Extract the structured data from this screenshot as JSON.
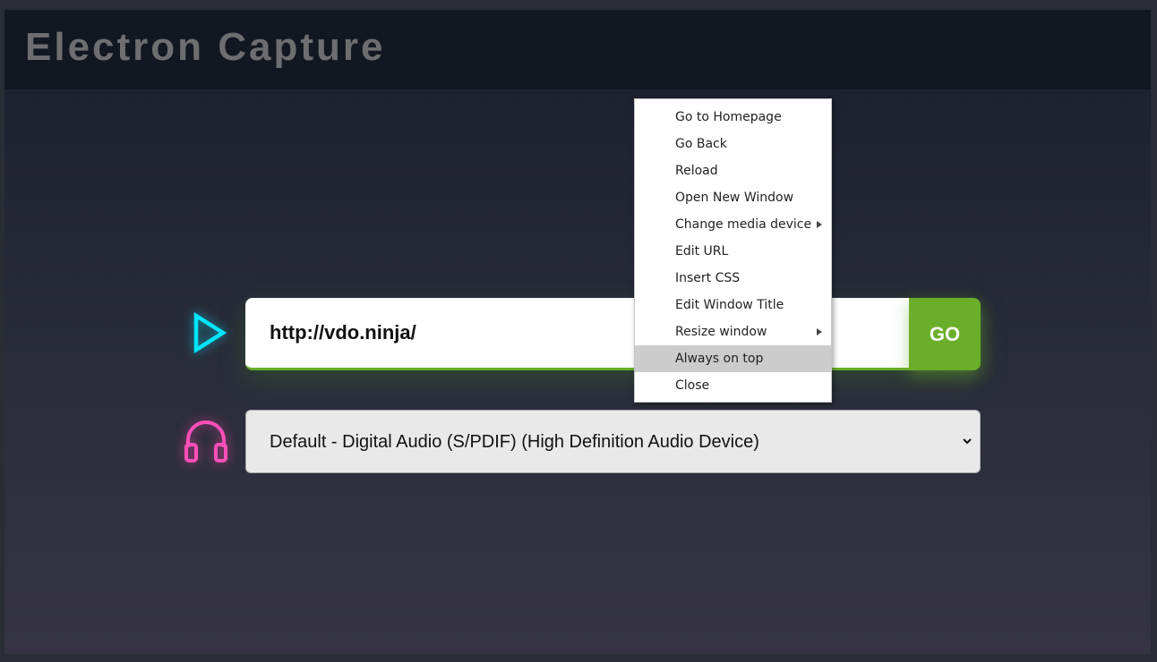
{
  "app": {
    "title": "Electron Capture"
  },
  "url_bar": {
    "value": "http://vdo.ninja/",
    "go_label": "GO"
  },
  "audio_device": {
    "selected": "Default - Digital Audio (S/PDIF) (High Definition Audio Device)"
  },
  "context_menu": {
    "items": [
      {
        "label": "Go to Homepage",
        "submenu": false,
        "highlighted": false
      },
      {
        "label": "Go Back",
        "submenu": false,
        "highlighted": false
      },
      {
        "label": "Reload",
        "submenu": false,
        "highlighted": false
      },
      {
        "label": "Open New Window",
        "submenu": false,
        "highlighted": false
      },
      {
        "label": "Change media device",
        "submenu": true,
        "highlighted": false
      },
      {
        "label": "Edit URL",
        "submenu": false,
        "highlighted": false
      },
      {
        "label": "Insert CSS",
        "submenu": false,
        "highlighted": false
      },
      {
        "label": "Edit Window Title",
        "submenu": false,
        "highlighted": false
      },
      {
        "label": "Resize window",
        "submenu": true,
        "highlighted": false
      },
      {
        "label": "Always on top",
        "submenu": false,
        "highlighted": true
      },
      {
        "label": "Close",
        "submenu": false,
        "highlighted": false
      }
    ]
  },
  "icons": {
    "play": "play-icon",
    "headphones": "headphones-icon",
    "dropdown": "chevron-down-icon",
    "submenu": "chevron-right-icon"
  },
  "colors": {
    "accent_green": "#6aae2a",
    "play_cyan": "#00e5ff",
    "headphones_pink": "#ff4fb8",
    "title_gray": "#6e6e72"
  }
}
